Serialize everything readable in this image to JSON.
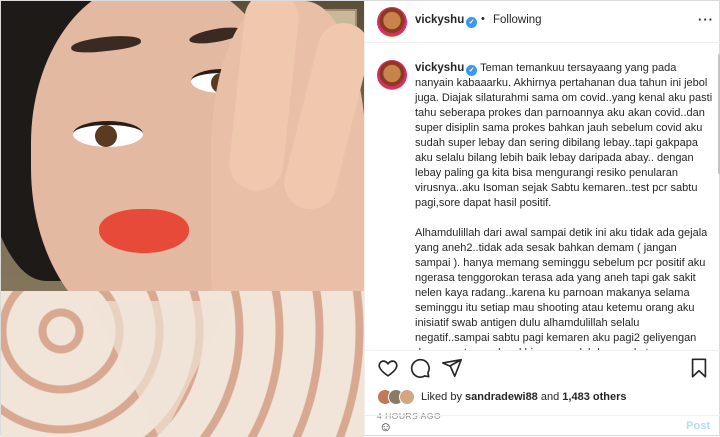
{
  "post": {
    "username": "vickyshu",
    "verified_mark": "✓",
    "separator": "•",
    "follow_status": "Following",
    "more_label": "···",
    "caption_text": "Teman temankuu tersayaang yang pada nanyain kabaaarku. Akhirnya pertahanan dua tahun ini jebol juga. Diajak silaturahmi sama om covid..yang kenal aku pasti tahu seberapa prokes dan parnoannya aku akan covid..dan super disiplin sama prokes bahkan jauh sebelum covid aku sudah super lebay dan sering dibilang lebay..tapi gakpapa aku selalu bilang lebih baik lebay daripada abay.. dengan lebay paling ga kita bisa mengurangi resiko penularan virusnya..aku Isoman sejak Sabtu kemaren..test pcr sabtu pagi,sore dapat hasil positif.\n\nAlhamdulillah dari awal sampai detik ini aku tidak ada gejala yang aneh2..tidak ada sesak bahkan demam ( jangan sampai ). hanya memang seminggu sebelum pcr positif aku ngerasa tenggorokan terasa ada yang aneh tapi gak sakit nelen kaya radang..karena ku parnoan makanya selama seminggu itu setiap mau shooting atau ketemu orang aku inisiatif swab antigen dulu alhamdulillah selalu negatif..sampai sabtu pagi kemaren aku pagi2 geliyengan dan gemeteran aku akhirnya pcr deh karena katanya mas ade juga ga enak tenggorokan. PCR berdua, Eh ternyata hasilnya aku positif dan mas ade negatif. Langsung lah aku isoman, konsultasi telemedicine"
  },
  "footer": {
    "liked_prefix": "Liked by",
    "liked_user": "sandradewi88",
    "liked_and": "and",
    "liked_count": "1,483 others",
    "timestamp": "4 HOURS AGO",
    "emoji_icon": "☺",
    "post_label": "Post"
  },
  "icons": [
    "heart-icon",
    "comment-icon",
    "share-icon",
    "save-icon",
    "more-icon",
    "verified-icon",
    "emoji-icon"
  ],
  "colors": {
    "accent_blue": "#3897f0",
    "post_button_disabled": "#b3dbff",
    "muted_text": "#8e8e8e",
    "lipstick": "#e84a3a"
  }
}
